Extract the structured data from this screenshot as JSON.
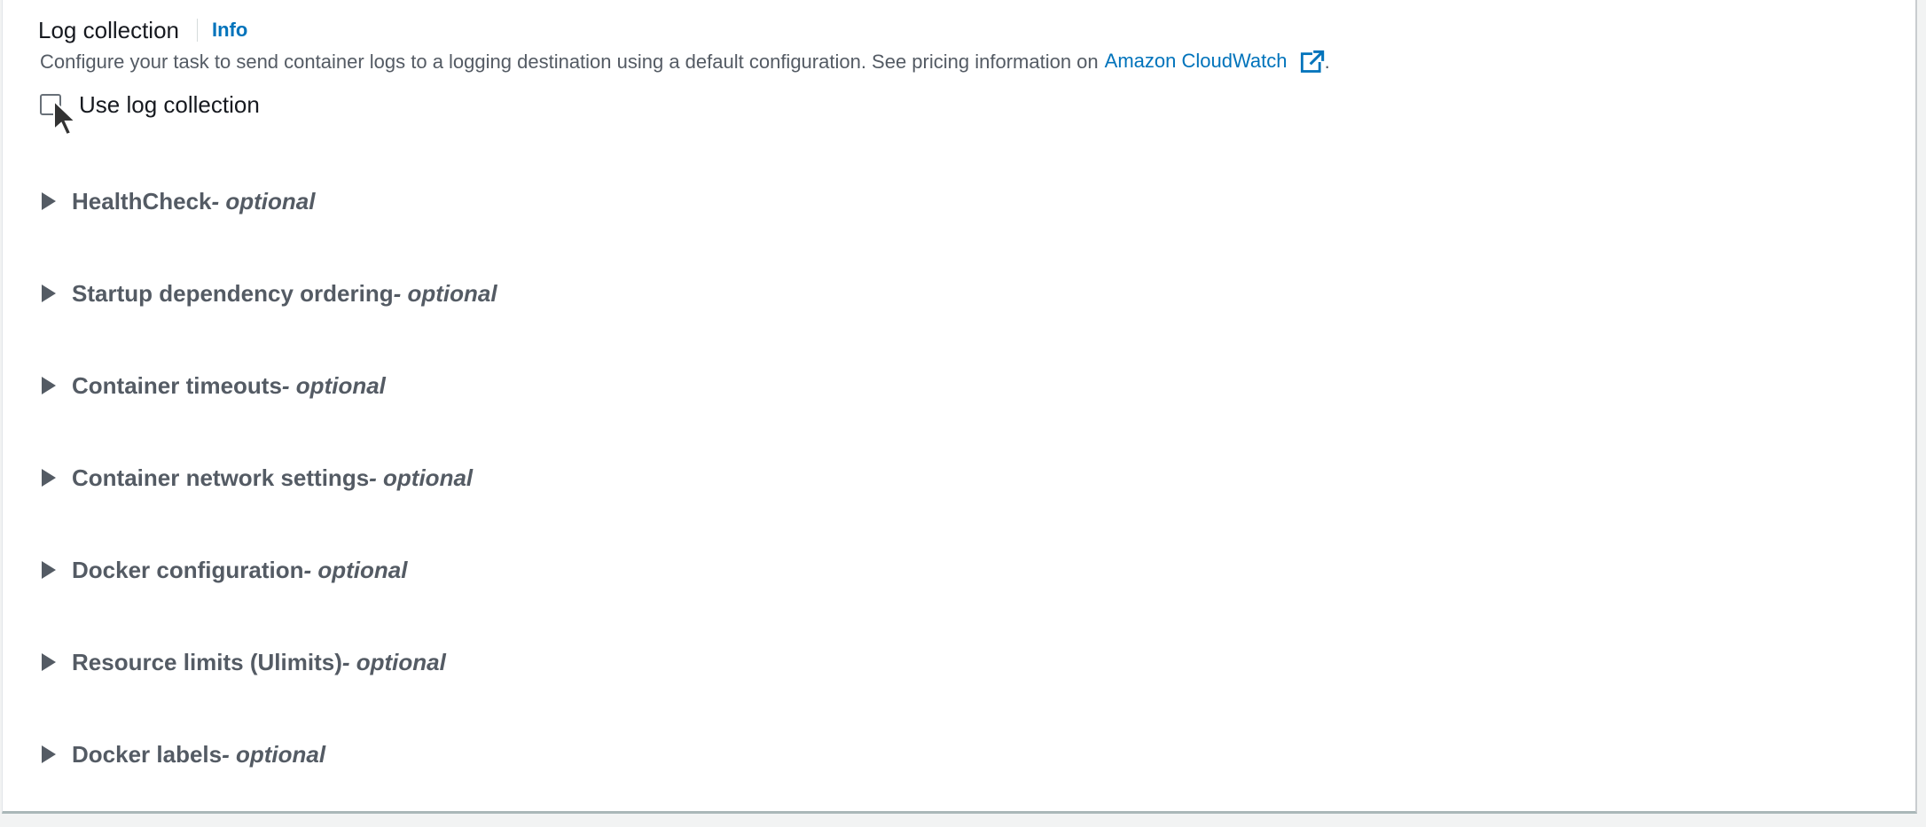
{
  "log_collection": {
    "title": "Log collection",
    "info_label": "Info",
    "description": "Configure your task to send container logs to a logging destination using a default configuration. See pricing information on",
    "link_text": "Amazon CloudWatch",
    "period": ".",
    "checkbox_label": "Use log collection",
    "checkbox_checked": false
  },
  "expanders": [
    {
      "title": "HealthCheck",
      "suffix": " - optional"
    },
    {
      "title": "Startup dependency ordering",
      "suffix": " - optional"
    },
    {
      "title": "Container timeouts",
      "suffix": " - optional"
    },
    {
      "title": "Container network settings",
      "suffix": " - optional"
    },
    {
      "title": "Docker configuration",
      "suffix": " - optional"
    },
    {
      "title": "Resource limits (Ulimits)",
      "suffix": " - optional"
    },
    {
      "title": "Docker labels",
      "suffix": " - optional"
    }
  ],
  "icons": {
    "external_link": "external-link-icon",
    "expand": "caret-right-icon",
    "pointer": "mouse-pointer-icon"
  },
  "colors": {
    "link": "#0073bb",
    "text": "#16191f",
    "secondary_text": "#545b64"
  }
}
